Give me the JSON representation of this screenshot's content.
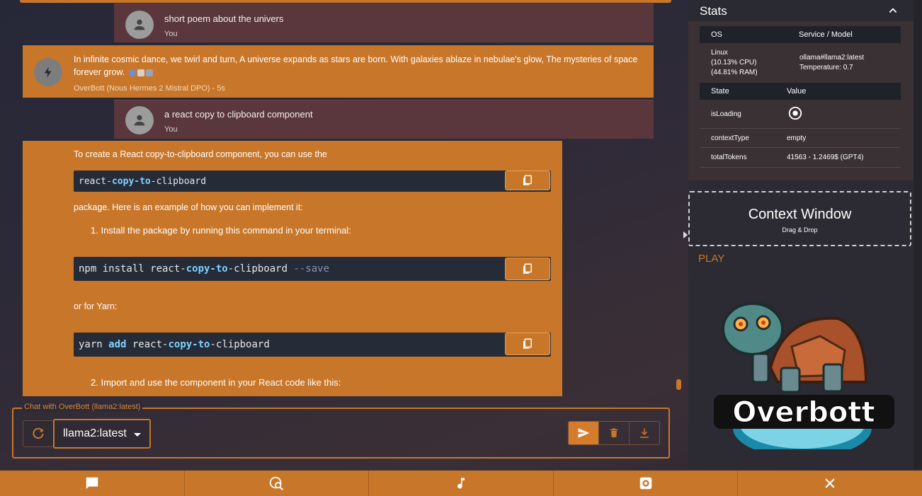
{
  "chat": {
    "messages": [
      {
        "role": "user",
        "text": "short poem about the univers",
        "meta": "You"
      },
      {
        "role": "bot",
        "text": "In infinite cosmic dance, we twirl and turn, A universe expands as stars are born. With galaxies ablaze in nebulae's glow, The mysteries of space forever grow.",
        "meta": "OverBott (Nous Hermes 2 Mistral DPO) - 5s"
      },
      {
        "role": "user",
        "text": "a react copy to clipboard component",
        "meta": "You"
      }
    ],
    "answer": {
      "intro": "To create a React copy-to-clipboard component, you can use the",
      "code1": {
        "a": "react-",
        "kw": "copy-to",
        "b": "-clipboard"
      },
      "para2": "package. Here is an example of how you can implement it:",
      "step1": "1. Install the package by running this command in your terminal:",
      "code2": {
        "a": "npm install react-",
        "kw": "copy-to",
        "b": "-clipboard ",
        "flag": "--save"
      },
      "para3": "or for Yarn:",
      "code3": {
        "a": "yarn ",
        "kw1": "add",
        "b": " react-",
        "kw2": "copy-to",
        "c": "-clipboard"
      },
      "step2": "2. Import and use the component in your React code like this:"
    }
  },
  "input": {
    "legend": "Chat with OverBott (llama2:latest)",
    "model": "llama2:latest"
  },
  "stats": {
    "title": "Stats",
    "table1": {
      "headers": [
        "OS",
        "Service / Model"
      ],
      "os": [
        "Linux",
        "(10.13% CPU)",
        "(44.81% RAM)"
      ],
      "service": [
        "ollama#llama2:latest",
        "Temperature: 0.7"
      ]
    },
    "table2": {
      "headers": [
        "State",
        "Value"
      ],
      "rows": [
        {
          "key": "isLoading",
          "value": ""
        },
        {
          "key": "contextType",
          "value": "empty"
        },
        {
          "key": "totalTokens",
          "value": "41563 - 1.2469$ (GPT4)"
        }
      ]
    }
  },
  "context_window": {
    "title": "Context Window",
    "subtitle": "Drag & Drop"
  },
  "play": {
    "label": "PLAY"
  },
  "logo": {
    "text": "Overbott"
  },
  "colors": {
    "accent": "#c8772a",
    "user_bubble": "#5a373c",
    "code_bg": "#262b38"
  },
  "icons": [
    "person-icon",
    "bolt-icon",
    "copy-icon",
    "refresh-icon",
    "send-icon",
    "trash-icon",
    "download-icon",
    "chevron-up-icon",
    "radio-icon",
    "chat-icon",
    "search-web-icon",
    "music-icon",
    "settings-icon",
    "close-icon"
  ]
}
